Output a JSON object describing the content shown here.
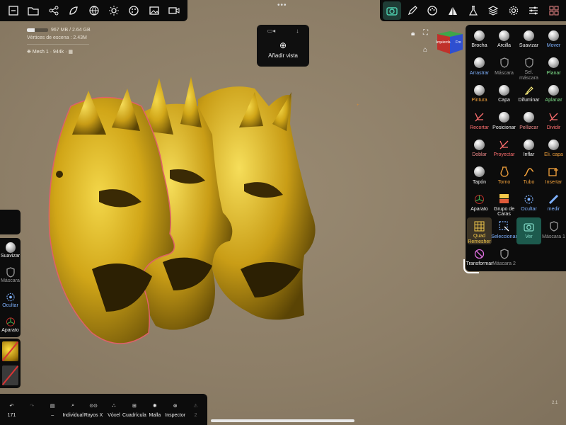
{
  "top_left_icons": [
    "undo-redo-icon",
    "folder-icon",
    "share-nodes-icon",
    "scene-icon",
    "globe-icon",
    "sun-icon",
    "palette-icon",
    "image-icon",
    "video-camera-icon"
  ],
  "top_right_icons": [
    "camera-icon",
    "pen-icon",
    "paint-palette-icon",
    "triangle-icon",
    "flask-icon",
    "layers-icon",
    "gear-icon",
    "sliders-icon",
    "settings-grid-icon"
  ],
  "stats": {
    "memory": "967 MB / 2.64 GB",
    "memory_fraction": 0.37,
    "vertices": "Vértices de escena : 2.43M",
    "mesh": "Mesh 1 · 944k · "
  },
  "view_panel": {
    "add_view": "Añadir vista"
  },
  "cube": {
    "face_left": "Izquierda",
    "face_right": "Fro"
  },
  "tools": [
    {
      "label": "Brocha",
      "color": "white",
      "icon": "ball"
    },
    {
      "label": "Arcilla",
      "color": "white",
      "icon": "ball"
    },
    {
      "label": "Suavizar",
      "color": "white",
      "icon": "ball"
    },
    {
      "label": "Mover",
      "color": "blue",
      "icon": "ball"
    },
    {
      "label": "Arrastrar",
      "color": "blue",
      "icon": "ball"
    },
    {
      "label": "Máscara",
      "color": "grey",
      "icon": "shield"
    },
    {
      "label": "Sel. máscara",
      "color": "grey",
      "icon": "shield"
    },
    {
      "label": "Planar",
      "color": "green",
      "icon": "ball"
    },
    {
      "label": "Pintura",
      "color": "orange",
      "icon": "ball"
    },
    {
      "label": "Capa",
      "color": "white",
      "icon": "ball"
    },
    {
      "label": "Difuminar",
      "color": "white",
      "icon": "brush"
    },
    {
      "label": "Aplanar",
      "color": "green",
      "icon": "ball"
    },
    {
      "label": "Recortar",
      "color": "red",
      "icon": "cut"
    },
    {
      "label": "Posicionar",
      "color": "white",
      "icon": "ball"
    },
    {
      "label": "Pellizcar",
      "color": "pink",
      "icon": "ball"
    },
    {
      "label": "Dividir",
      "color": "red",
      "icon": "cut"
    },
    {
      "label": "Doblar",
      "color": "pink",
      "icon": "ball"
    },
    {
      "label": "Proyectar",
      "color": "red",
      "icon": "cut"
    },
    {
      "label": "Inflar",
      "color": "white",
      "icon": "ball"
    },
    {
      "label": "Eli. capa",
      "color": "orange",
      "icon": "ball"
    },
    {
      "label": "Tapón",
      "color": "white",
      "icon": "ball"
    },
    {
      "label": "Torno",
      "color": "orange",
      "icon": "vase"
    },
    {
      "label": "Tubo",
      "color": "orange",
      "icon": "curve"
    },
    {
      "label": "Insertar",
      "color": "orange",
      "icon": "insert"
    },
    {
      "label": "Aparato",
      "color": "white",
      "icon": "gizmo"
    },
    {
      "label": "Grupo de Caras",
      "color": "white",
      "icon": "faces"
    },
    {
      "label": "Ocultar",
      "color": "blue",
      "icon": "hide"
    },
    {
      "label": "medir",
      "color": "blue",
      "icon": "ruler"
    },
    {
      "label": "Quad Remesher",
      "color": "yellow",
      "icon": "grid"
    },
    {
      "label": "Seleccionar",
      "color": "blue",
      "icon": "select"
    },
    {
      "label": "Ver",
      "color": "teal",
      "icon": "camera"
    },
    {
      "label": "Máscara 1",
      "color": "grey",
      "icon": "shield"
    },
    {
      "label": "Transformar",
      "color": "white",
      "icon": "transform"
    },
    {
      "label": "Máscara 2",
      "color": "grey",
      "icon": "shield"
    }
  ],
  "left_tools": [
    {
      "label": "Suavizar",
      "color": "white"
    },
    {
      "label": "Máscara",
      "color": "grey"
    },
    {
      "label": "Ocultar",
      "color": "blue"
    },
    {
      "label": "Aparato",
      "color": "white"
    }
  ],
  "bottom": {
    "undo_count": "171",
    "items": [
      {
        "label": "Individual"
      },
      {
        "label": "Rayos X"
      },
      {
        "label": "Vóxel"
      },
      {
        "label": "Cuadrícula"
      },
      {
        "label": "Malla"
      },
      {
        "label": "Inspector"
      },
      {
        "label": "2"
      }
    ]
  },
  "corner_label": "2.1"
}
